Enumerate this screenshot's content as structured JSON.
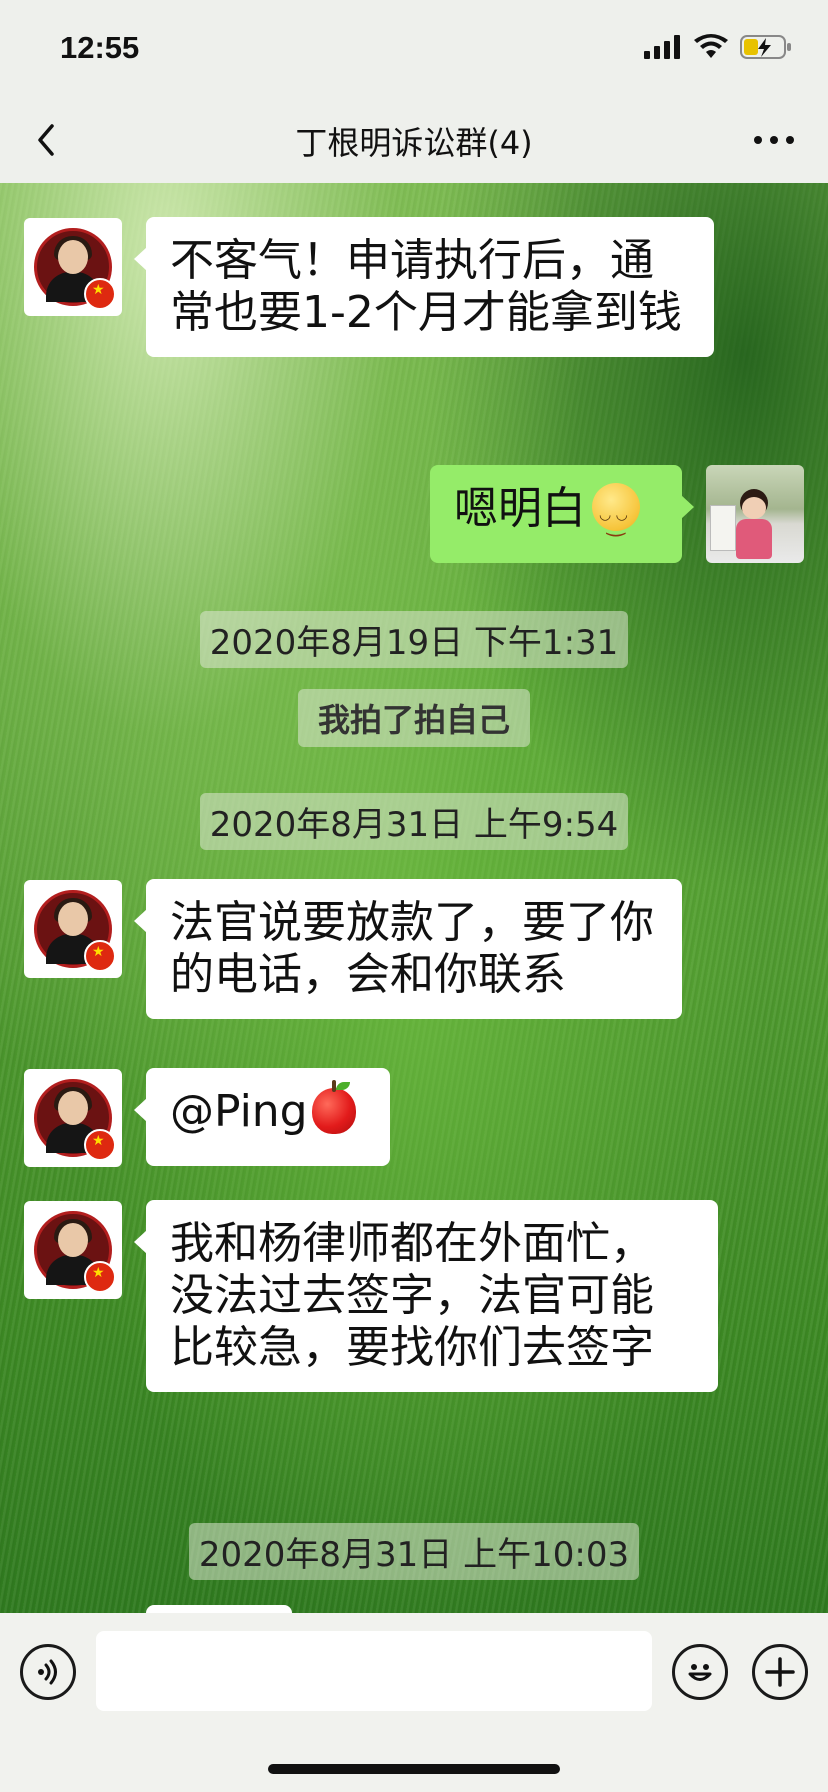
{
  "status_bar": {
    "time": "12:55"
  },
  "nav": {
    "title": "丁根明诉讼群(4)"
  },
  "messages": [
    {
      "text": "不客气！申请执行后，通常也要1-2个月才能拿到钱"
    },
    {
      "text": "嗯明白"
    },
    {
      "timestamp": "2020年8月19日 下午1:31"
    },
    {
      "system": "我拍了拍自己"
    },
    {
      "timestamp": "2020年8月31日 上午9:54"
    },
    {
      "text": "法官说要放款了，要了你的电话，会和你联系"
    },
    {
      "text": "@Ping"
    },
    {
      "text": "我和杨律师都在外面忙，没法过去签字，法官可能比较急，要找你们去签字"
    },
    {
      "timestamp": "2020年8月31日 上午10:03"
    }
  ],
  "colors": {
    "my_bubble": "#95ec69",
    "other_bubble": "#ffffff"
  }
}
